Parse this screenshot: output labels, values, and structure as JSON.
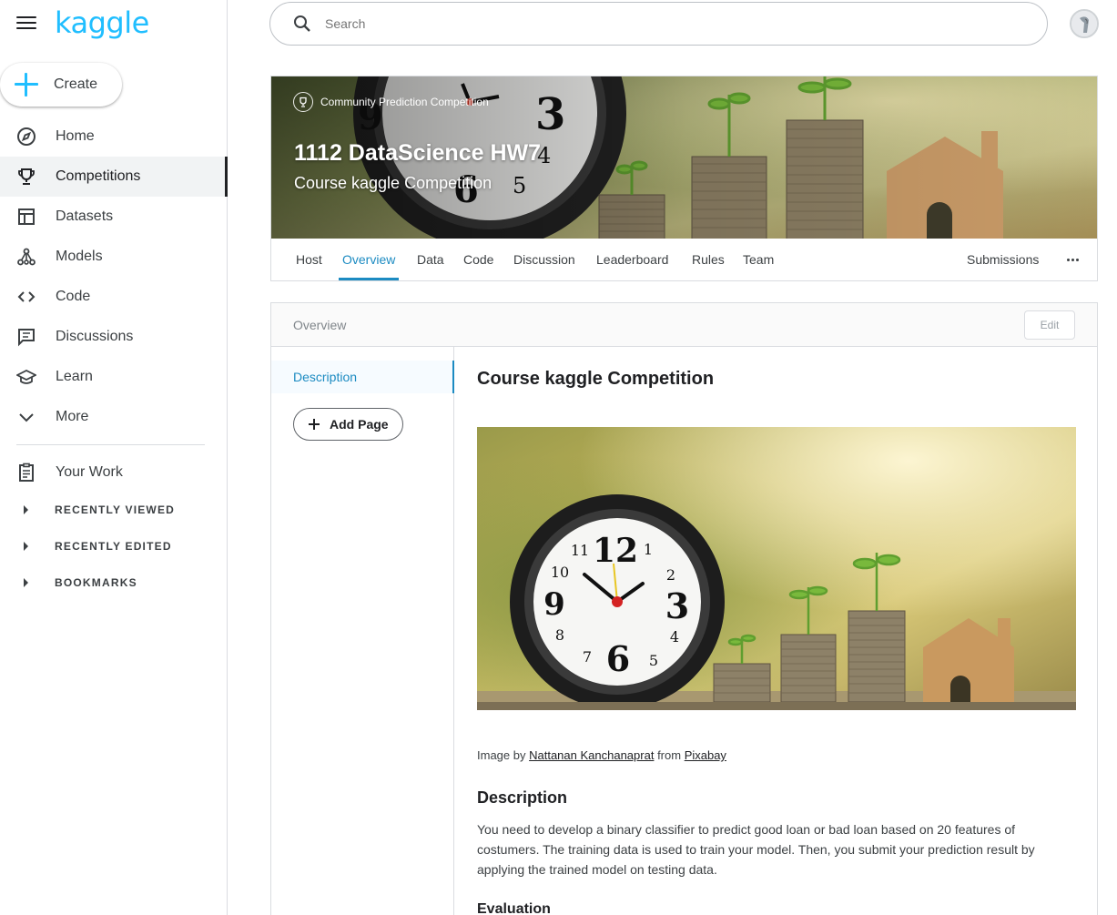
{
  "app": {
    "logo": "kaggle"
  },
  "sidebar": {
    "create_label": "Create",
    "items": [
      {
        "label": "Home",
        "icon": "compass-icon"
      },
      {
        "label": "Competitions",
        "icon": "trophy-icon",
        "active": true
      },
      {
        "label": "Datasets",
        "icon": "table-icon"
      },
      {
        "label": "Models",
        "icon": "models-icon"
      },
      {
        "label": "Code",
        "icon": "code-icon"
      },
      {
        "label": "Discussions",
        "icon": "comment-icon"
      },
      {
        "label": "Learn",
        "icon": "school-icon"
      },
      {
        "label": "More",
        "icon": "chevron-down-icon"
      }
    ],
    "your_work": "Your Work",
    "sections": [
      "RECENTLY VIEWED",
      "RECENTLY EDITED",
      "BOOKMARKS"
    ]
  },
  "search": {
    "placeholder": "Search"
  },
  "banner": {
    "tag": "Community Prediction Competition",
    "title": "1112 DataScience HW7",
    "subtitle": "Course kaggle Competition"
  },
  "tabs": {
    "items": [
      "Host",
      "Overview",
      "Data",
      "Code",
      "Discussion",
      "Leaderboard",
      "Rules",
      "Team"
    ],
    "active": "Overview",
    "submissions": "Submissions"
  },
  "overview": {
    "header": "Overview",
    "edit_label": "Edit",
    "nav_description": "Description",
    "add_page": "Add Page",
    "title": "Course kaggle Competition",
    "credit": {
      "prefix": "Image by",
      "author": "Nattanan Kanchanaprat",
      "middle": "from",
      "source": "Pixabay"
    },
    "description_heading": "Description",
    "description_text": "You need to develop a binary classifier to predict good loan or bad loan based on 20 features of costumers. The training data is used to train your model. Then, you submit your prediction result by applying the trained model on testing data.",
    "evaluation_heading": "Evaluation"
  },
  "colors": {
    "accent": "#20beff",
    "link": "#1c8bc2"
  }
}
